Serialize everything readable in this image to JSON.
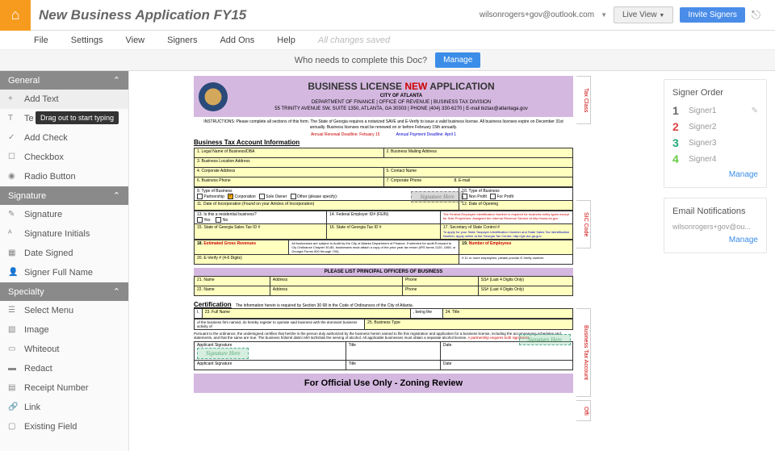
{
  "top": {
    "title": "New Business Application FY15",
    "email": "wilsonrogers+gov@outlook.com",
    "live_view": "Live View",
    "invite": "Invite Signers"
  },
  "menu": {
    "file": "File",
    "settings": "Settings",
    "view": "View",
    "signers": "Signers",
    "addons": "Add Ons",
    "help": "Help",
    "saved": "All changes saved"
  },
  "banner": {
    "q": "Who needs to complete this Doc?",
    "btn": "Manage"
  },
  "sidebar": {
    "general": {
      "h": "General",
      "items": [
        {
          "l": "Add Text",
          "tip": "Drag out to start typing"
        },
        {
          "l": "Te"
        },
        {
          "l": "Add Check"
        },
        {
          "l": "Checkbox"
        },
        {
          "l": "Radio Button"
        }
      ]
    },
    "signature": {
      "h": "Signature",
      "items": [
        {
          "l": "Signature"
        },
        {
          "l": "Signature Initials"
        },
        {
          "l": "Date Signed"
        },
        {
          "l": "Signer Full Name"
        }
      ]
    },
    "specialty": {
      "h": "Specialty",
      "items": [
        {
          "l": "Select Menu"
        },
        {
          "l": "Image"
        },
        {
          "l": "Whiteout"
        },
        {
          "l": "Redact"
        },
        {
          "l": "Receipt Number"
        },
        {
          "l": "Link"
        },
        {
          "l": "Existing Field"
        }
      ]
    }
  },
  "doc": {
    "title_a": "BUSINESS LICENSE ",
    "title_new": "NEW",
    "title_b": " APPLICATION",
    "city": "CITY OF ATLANTA",
    "dept": "DEPARTMENT OF FINANCE | OFFICE OF REVENUE | BUSINESS TAX DIVISION",
    "addr": "55 TRINITY AVENUE SW, SUITE 1350, ATLANTA, GA 30303 | PHONE (404) 330-6270 | E-mail biztax@atlantaga.gov",
    "instr": "INSTRUCTIONS: Please complete all sections of this form. The State of Georgia requires a notarized SAVE and E-Verify to issue a valid business license. All business licenses expire on December 31st annually. Business licenses must be renewed on or before February 15th annually.",
    "deadline_r": "Annual Renewal Deadline: Febuary 15",
    "deadline_b": "Annual Payment Deadline: April 1",
    "sec1": "Business Tax Account Information",
    "f1": "1.   Legal Name of Business/DBA",
    "f2": "2.   Business Mailing Address",
    "f3": "3.   Business Location Address",
    "f4": "4.   Corporate Address",
    "f5": "5.   Contact Name",
    "f6": "6.   Business Phone",
    "f7": "7.   Corporate Phone",
    "f8": "8.   E-mail",
    "f9": "9.   Type of Business",
    "f10": "10.  Type of  Business",
    "f9a": "Partnership",
    "f9b": "Corporation",
    "f9c": "Sole Owner",
    "f9d": "Other (please specify):",
    "f10a": "Non Profit",
    "f10b": "For Profit",
    "f11": "11.  Date of Incorporation (Found on your Articles of Incorporation)",
    "f12": "12.  Date of Opening",
    "f13": "13. Is this a residential business?",
    "f13y": "Yes",
    "f13n": "No",
    "f14": "14.  Federal Employer ID# (FEIN)",
    "f15": "15. State of Georgia Sales Tax ID #",
    "f16": "16. State of Georgia Tax ID #",
    "f17": "17.  Secretary of State Control #",
    "f18": "18.",
    "f18t": "Estimated Gross Revenues",
    "f19": "19.",
    "f19t": "Number of Employees",
    "f18note": "All businesses are subject to Audit by the City of Atlanta Department of Finance. If selected for audit.Pursuant to Cty Ordinance Chapter 30-85, businesses must attach a copy of the prior year tax return (IRS forms 1120, 1065, or Georgia Forms 500 through 700).",
    "f19note": "If 11 or more employees, please provide E-Verify number.",
    "f20": "20. E-Verify # (4-6 Digits)",
    "officers": "PLEASE LIST PRINCIPAL OFFICERS OF BUSINESS",
    "oh1": "21.  Name",
    "oh2": "Address",
    "oh3": "Phone",
    "oh4": "SS# (Last 4 Digits Only)",
    "oh5": "22.  Name",
    "oh6": "Address",
    "oh7": "Phone",
    "oh8": "SS# (Last 4 Digits Only)",
    "cert": "Certification",
    "cert_t": "The information herein is required by Section 30 68 in the Code of Ordinances of the City of Atlanta.",
    "f23": "23.   Full Name",
    "f23b": ", being the",
    "f24": "24.   Title",
    "cert2": "of the business firm named, do hereby register to operate said business with the dominant business activity of",
    "f25": "25.  Business Type",
    "cert3": "Pursuant to the ordinance, the undersigned certifies that he/she is the person duly authorized by the business herein named to file this registration and application for a business license, including the accompanying schedules and statements, and that the same are true. The business hûlsmê dabní nĕrï lazhshab the serving of alcohol. All applicable businesses must obtain a separate alcohol license.",
    "cert3r": "A partnership requires both signatures.",
    "sig_app": "Applicant Signature",
    "sig_title": "Title",
    "sig_date": "Date",
    "sig_text": "Signature Here",
    "zoning": "For Official Use Only - Zoning Review",
    "smalltext1": "The Federal Employee Identification Number is required for business entity types except for Sole Proprietors. Assigned the Internal Revenue Service at http://www.irs.gov",
    "smalltext2": "To apply for your State Taxpayer Identification Number and State Sales Tax Identification Number, apply online at the Georgia Tax Center: http://gtc.dor.ga.gov"
  },
  "vtabs": {
    "t1": "Tax Class",
    "t2": "SIC Code",
    "t3": "Business Tax Account",
    "t4": "Offi"
  },
  "signer": {
    "h": "Signer Order",
    "s1": "Signer1",
    "s2": "Signer2",
    "s3": "Signer3",
    "s4": "Signer4",
    "manage": "Manage"
  },
  "notif": {
    "h": "Email Notifications",
    "email": "wilsonrogers+gov@ou...",
    "manage": "Manage"
  }
}
